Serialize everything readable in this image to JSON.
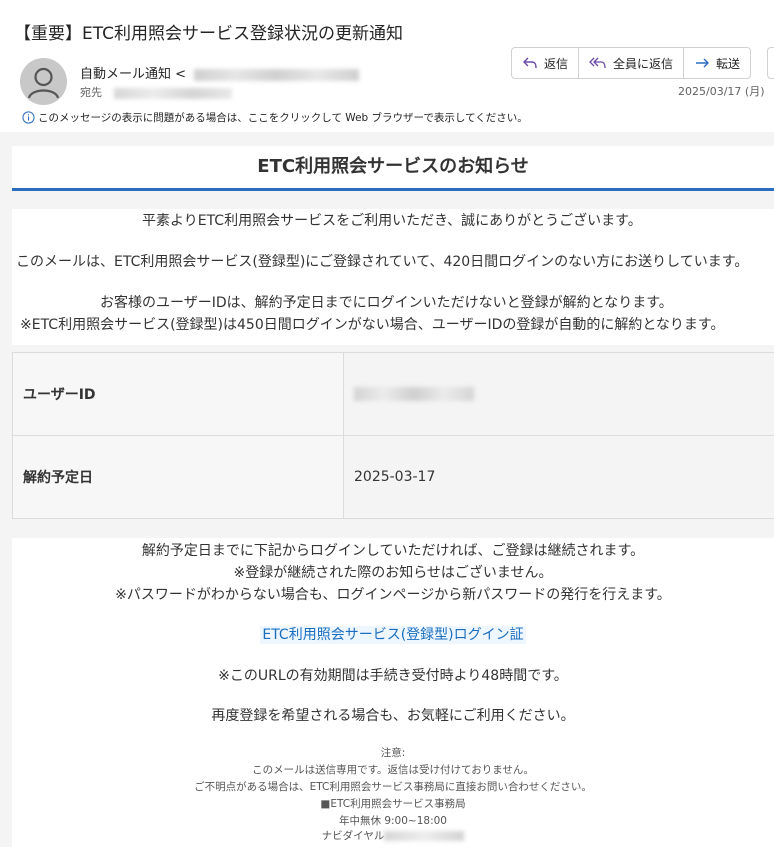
{
  "header": {
    "subject": "【重要】ETC利用照会サービス登録状況の更新通知",
    "sender_name": "自動メール通知",
    "sender_prefix": "<",
    "to_label": "宛先",
    "date": "2025/03/17 (月)",
    "info_notice": "このメッセージの表示に問題がある場合は、ここをクリックして Web ブラウザーで表示してください。"
  },
  "actions": {
    "reply": "返信",
    "reply_all": "全員に返信",
    "forward": "転送"
  },
  "email": {
    "title": "ETC利用照会サービスのお知らせ",
    "intro": [
      "平素よりETC利用照会サービスをご利用いただき、誠にありがとうございます。",
      "このメールは、ETC利用照会サービス(登録型)にご登録されていて、420日間ログインのない方にお送りしています。",
      "お客様のユーザーIDは、解約予定日までにログインいただけないと登録が解約となります。",
      "※ETC利用照会サービス(登録型)は450日間ログインがない場合、ユーザーIDの登録が自動的に解約となります。"
    ],
    "table": {
      "user_id_label": "ユーザーID",
      "cancel_date_label": "解約予定日",
      "cancel_date_value": "2025-03-17"
    },
    "body": [
      "解約予定日までに下記からログインしていただければ、ご登録は継続されます。",
      "※登録が継続された際のお知らせはございません。",
      "※パスワードがわからない場合も、ログインページから新パスワードの発行を行えます。"
    ],
    "login_link": "ETC利用照会サービス(登録型)ログイン証",
    "url_validity": "※このURLの有効期間は手続き受付時より48時間です。",
    "re_register": "再度登録を希望される場合も、お気軽にご利用ください。",
    "footer": {
      "note_label": "注意:",
      "line1": "このメールは送信専用です。返信は受け付けておりません。",
      "line2": "ご不明点がある場合は、ETC利用照会サービス事務局に直接お問い合わせください。",
      "line3": "■ETC利用照会サービス事務局",
      "line4": "年中無休 9:00~18:00",
      "line5": "ナビダイヤル"
    }
  }
}
